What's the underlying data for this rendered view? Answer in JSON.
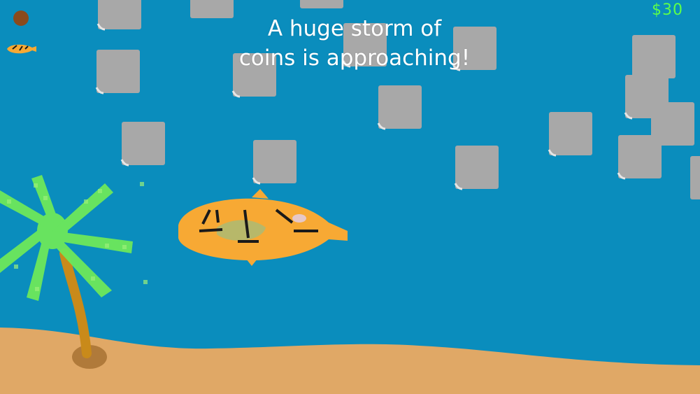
{
  "hud": {
    "money": "$30"
  },
  "message": {
    "line1": "A huge storm of",
    "line2": "coins is approaching!"
  },
  "colors": {
    "water": "#0a8dbd",
    "sand": "#e0a866",
    "coin_block": "#a8a8a8",
    "palm_leaves": "#6ee85a",
    "palm_trunk": "#c98a1a",
    "fish": "#f7a934",
    "money_text": "#5dff4a"
  },
  "icons": [
    "food-pellet-icon",
    "fish-life-icon",
    "coin-block-icon",
    "palm-tree-icon",
    "fish-player-icon"
  ]
}
